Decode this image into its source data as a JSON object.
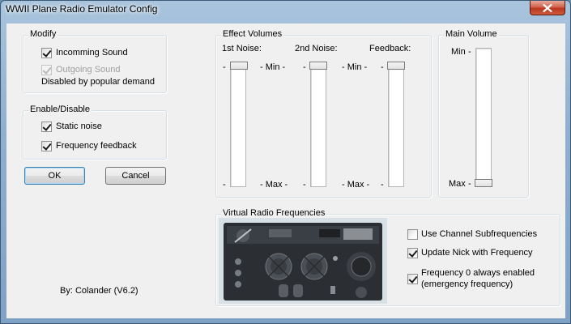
{
  "window": {
    "title": "WWII Plane Radio Emulator Config",
    "close_icon": "close-icon"
  },
  "modify": {
    "label": "Modify",
    "incoming_sound": {
      "label": "Incomming Sound",
      "checked": true
    },
    "outgoing_sound": {
      "label": "Outgoing Sound",
      "checked": true,
      "disabled": true
    },
    "disabled_note": "Disabled by popular demand"
  },
  "enable_disable": {
    "label": "Enable/Disable",
    "static_noise": {
      "label": "Static noise",
      "checked": true
    },
    "frequency_feedback": {
      "label": "Frequency feedback",
      "checked": true
    }
  },
  "buttons": {
    "ok": "OK",
    "cancel": "Cancel"
  },
  "credit": "By: Colander (V6.2)",
  "effect_volumes": {
    "label": "Effect Volumes",
    "noise1": {
      "label": "1st Noise:",
      "value_fraction": 0.0
    },
    "noise2": {
      "label": "2nd Noise:",
      "value_fraction": 0.0
    },
    "feedback": {
      "label": "Feedback:",
      "value_fraction": 0.0
    },
    "min_label": "- Min -",
    "max_label": "- Max -",
    "tick": "-"
  },
  "main_volume": {
    "label": "Main Volume",
    "min_label": "Min",
    "max_label": "Max",
    "tick": "-",
    "value_fraction": 1.0
  },
  "virtual_radio": {
    "label": "Virtual Radio Frequencies",
    "use_subfrequencies": {
      "label": "Use Channel Subfrequencies",
      "checked": false
    },
    "update_nick": {
      "label": "Update Nick with Frequency",
      "checked": true
    },
    "freq0_enabled": {
      "label_line1": "Frequency 0 always enabled",
      "label_line2": "(emergency frequency)",
      "checked": true
    }
  },
  "colors": {
    "title_gradient_top": "#a9c4dd",
    "client_bg": "#f0f0f0",
    "close_red": "#c7452c"
  }
}
